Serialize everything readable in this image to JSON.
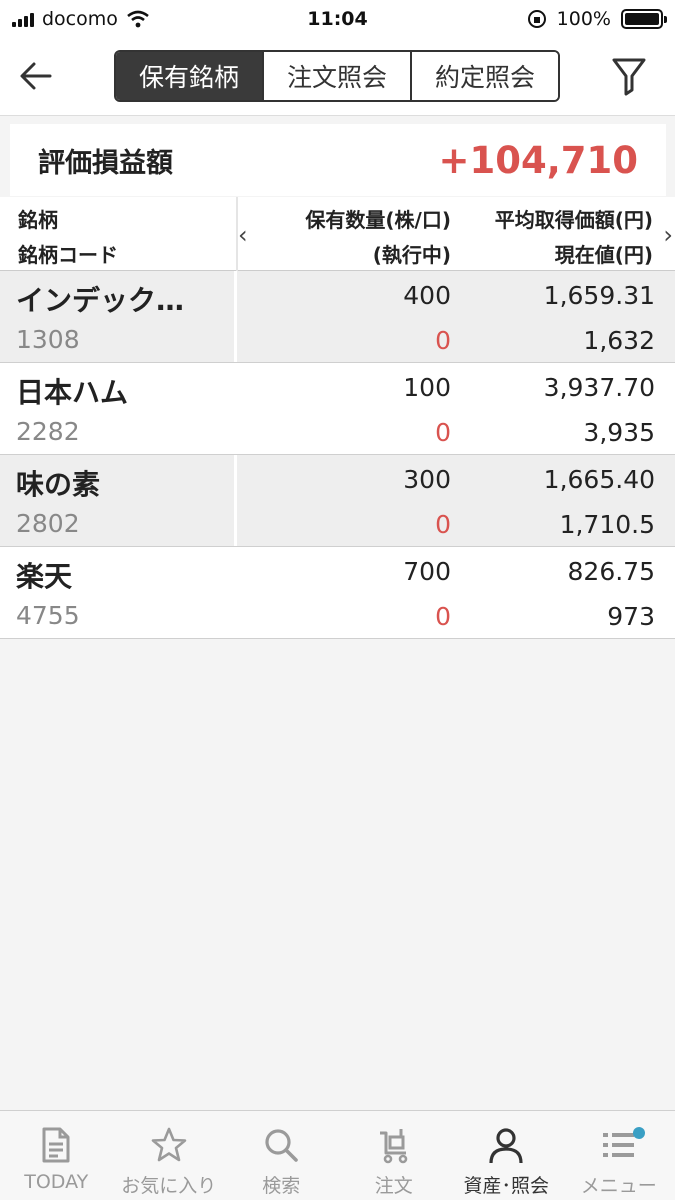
{
  "status": {
    "carrier": "docomo",
    "time": "11:04",
    "battery": "100%"
  },
  "header": {
    "tabs": [
      {
        "label": "保有銘柄",
        "active": true
      },
      {
        "label": "注文照会",
        "active": false
      },
      {
        "label": "約定照会",
        "active": false
      }
    ]
  },
  "summary": {
    "label": "評価損益額",
    "value": "+104,710"
  },
  "table": {
    "headers": {
      "name": "銘柄",
      "code": "銘柄コード",
      "qty": "保有数量(株/口)",
      "exec": "(執行中)",
      "avg": "平均取得価額(円)",
      "current": "現在値(円)"
    },
    "rows": [
      {
        "name": "インデック…",
        "code": "1308",
        "qty": "400",
        "exec": "0",
        "avg": "1,659.31",
        "current": "1,632"
      },
      {
        "name": "日本ハム",
        "code": "2282",
        "qty": "100",
        "exec": "0",
        "avg": "3,937.70",
        "current": "3,935"
      },
      {
        "name": "味の素",
        "code": "2802",
        "qty": "300",
        "exec": "0",
        "avg": "1,665.40",
        "current": "1,710.5"
      },
      {
        "name": "楽天",
        "code": "4755",
        "qty": "700",
        "exec": "0",
        "avg": "826.75",
        "current": "973"
      }
    ]
  },
  "tabbar": {
    "items": [
      {
        "label": "TODAY",
        "icon": "document-icon"
      },
      {
        "label": "お気に入り",
        "icon": "star-icon"
      },
      {
        "label": "検索",
        "icon": "search-icon"
      },
      {
        "label": "注文",
        "icon": "cart-icon"
      },
      {
        "label": "資産･照会",
        "icon": "person-icon"
      },
      {
        "label": "メニュー",
        "icon": "list-icon"
      }
    ]
  },
  "colors": {
    "accent_red": "#d9534f",
    "dark": "#3a3a3a",
    "badge": "#3a9fc4"
  }
}
